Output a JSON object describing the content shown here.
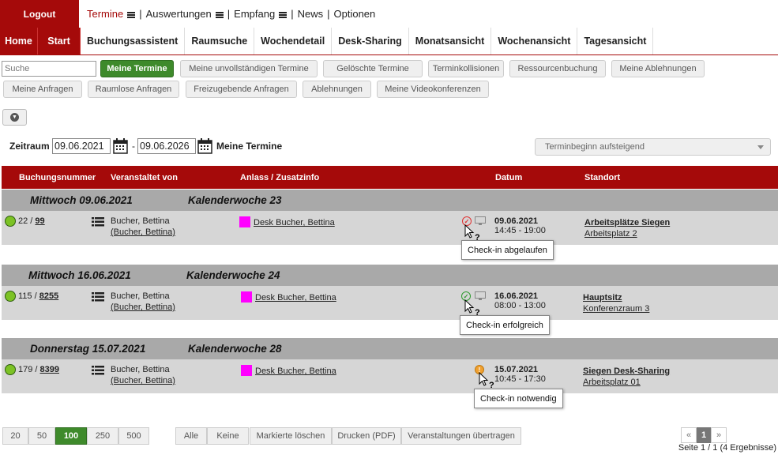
{
  "topbar": {
    "logout": "Logout",
    "menu": [
      {
        "label": "Termine",
        "active": true,
        "has_menu": true
      },
      {
        "label": "Auswertungen",
        "active": false,
        "has_menu": true
      },
      {
        "label": "Empfang",
        "active": false,
        "has_menu": true
      },
      {
        "label": "News",
        "active": false,
        "has_menu": false
      },
      {
        "label": "Optionen",
        "active": false,
        "has_menu": false
      }
    ]
  },
  "navbar": {
    "items": [
      "Home",
      "Start",
      "Buchungsassistent",
      "Raumsuche",
      "Wochendetail",
      "Desk-Sharing",
      "Monatsansicht",
      "Wochenansicht",
      "Tagesansicht"
    ]
  },
  "filters": {
    "search_placeholder": "Suche",
    "row1": [
      "Meine Termine",
      "Meine unvollständigen Termine",
      "Gelöschte Termine",
      "Terminkollisionen",
      "Ressourcenbuchung",
      "Meine Ablehnungen"
    ],
    "row2": [
      "Meine Anfragen",
      "Raumlose Anfragen",
      "Freizugebende Anfragen",
      "Ablehnungen",
      "Meine Videokonferenzen"
    ]
  },
  "period": {
    "label": "Zeitraum",
    "from": "09.06.2021",
    "to": "09.06.2026",
    "sep": "-",
    "view_label": "Meine Termine",
    "sort": "Terminbeginn aufsteigend"
  },
  "table": {
    "headers": [
      "Buchungsnummer",
      "Veranstaltet von",
      "Anlass / Zusatzinfo",
      "Datum",
      "Standort"
    ],
    "groups": [
      {
        "day": "Mittwoch 09.06.2021",
        "week": "Kalenderwoche 23",
        "row": {
          "num_prefix": "22 /",
          "num_link": "99",
          "org_name": "Bucher, Bettina",
          "org_link": "(Bucher, Bettina)",
          "occasion": "Desk Bucher, Bettina",
          "status_symbol": "✓",
          "status_color": "#e03030",
          "date": "09.06.2021",
          "time": "14:45 - 19:00",
          "location": "Arbeitsplätze Siegen",
          "sublocation": "Arbeitsplatz 2",
          "tooltip": "Check-in abgelaufen"
        }
      },
      {
        "day": "Mittwoch 16.06.2021",
        "week": "Kalenderwoche 24",
        "row": {
          "num_prefix": "115 /",
          "num_link": "8255",
          "org_name": "Bucher, Bettina",
          "org_link": "(Bucher, Bettina)",
          "occasion": "Desk Bucher, Bettina",
          "status_symbol": "✓",
          "status_color": "#2f9a2f",
          "date": "16.06.2021",
          "time": "08:00 - 13:00",
          "location": "Hauptsitz",
          "sublocation": "Konferenzraum 3",
          "tooltip": "Check-in erfolgreich"
        }
      },
      {
        "day": "Donnerstag 15.07.2021",
        "week": "Kalenderwoche 28",
        "row": {
          "num_prefix": "179 /",
          "num_link": "8399",
          "org_name": "Bucher, Bettina",
          "org_link": "(Bucher, Bettina)",
          "occasion": "Desk Bucher, Bettina",
          "status_symbol": "!",
          "status_color": "#f0a030",
          "date": "15.07.2021",
          "time": "10:45 - 17:30",
          "location": "Siegen Desk-Sharing",
          "sublocation": "Arbeitsplatz 01",
          "tooltip": "Check-in notwendig"
        }
      }
    ]
  },
  "footer": {
    "page_sizes": [
      "20",
      "50",
      "100",
      "250",
      "500"
    ],
    "active_size": "100",
    "actions": [
      "Alle",
      "Keine",
      "Markierte löschen",
      "Drucken (PDF)",
      "Veranstaltungen übertragen"
    ],
    "pager_prev": "«",
    "pager_current": "1",
    "pager_next": "»",
    "page_info": "Seite 1 / 1 (4 Ergebnisse)"
  },
  "colors": {
    "brand_red": "#a50a0a",
    "active_green": "#3e8a2b",
    "status_dot_green": "#7cc225",
    "occasion_magenta": "#ff00ff"
  }
}
